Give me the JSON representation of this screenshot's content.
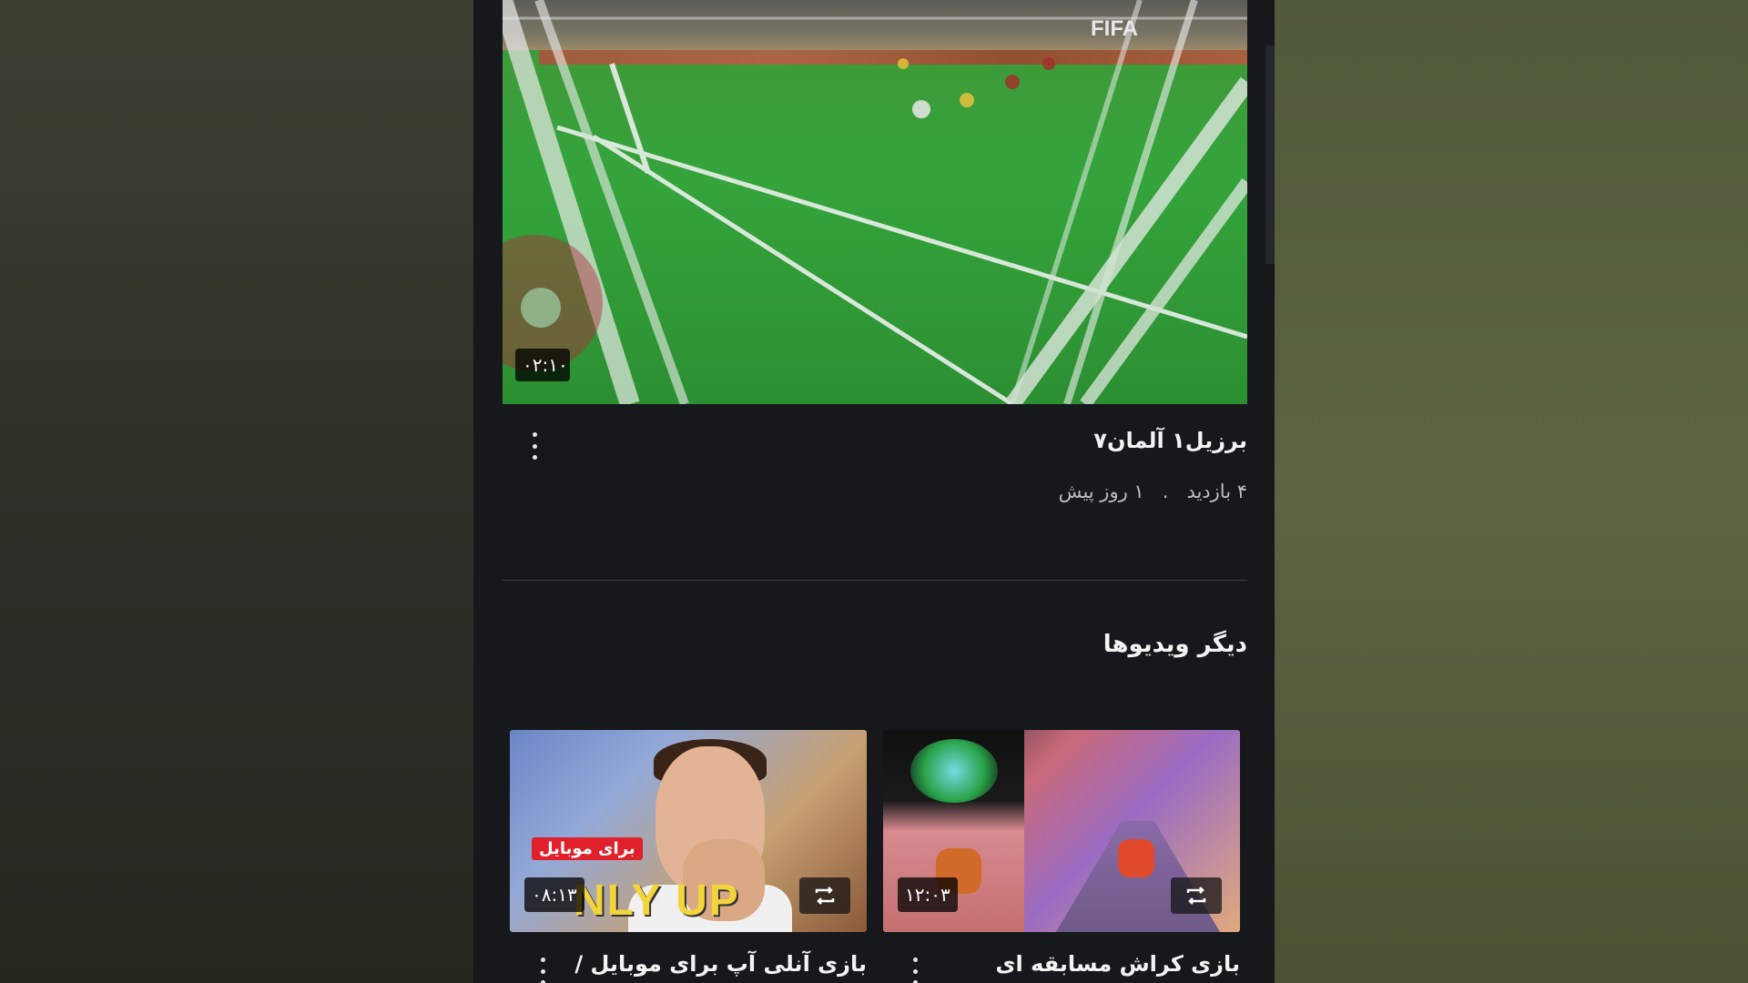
{
  "featured_video": {
    "thumbnail_overlay_text": "FIFA",
    "duration": "۰۲:۱۰",
    "title": "برزیل۱ آلمان۷",
    "views": "۴ بازدید",
    "separator": ".",
    "age": "۱ روز پیش"
  },
  "section": {
    "title": "دیگر ویدیوها"
  },
  "videos": [
    {
      "title": "بازی آنلی آپ برای موبایل /",
      "duration": "۰۸:۱۳",
      "badge": "برای موبایل",
      "thumb_text": "NLY   UP",
      "icon": "repeat-icon"
    },
    {
      "title": "بازی کراش مسابقه ای",
      "duration": "۱۲:۰۳",
      "icon": "repeat-icon"
    }
  ],
  "icons": {
    "more": "more-vertical-icon",
    "loop": "repeat-icon"
  },
  "colors": {
    "background": "#16181b",
    "text": "#f3f3f3",
    "meta_text": "#bdbdbd",
    "badge_red": "#e0212c"
  }
}
